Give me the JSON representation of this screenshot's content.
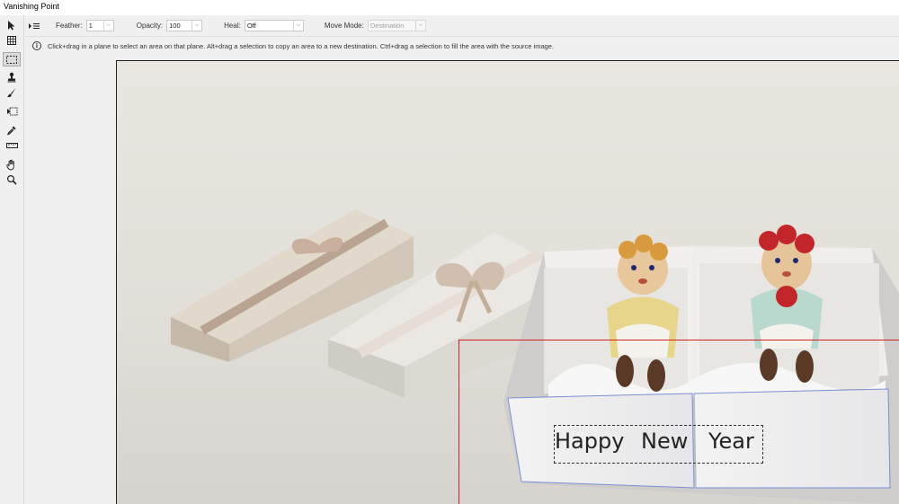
{
  "window": {
    "title": "Vanishing Point"
  },
  "options": {
    "menu_icon": "flyout-menu-icon",
    "feather": {
      "label": "Feather:",
      "value": "1"
    },
    "opacity": {
      "label": "Opacity:",
      "value": "100"
    },
    "heal": {
      "label": "Heal:",
      "value": "Off"
    },
    "move_mode": {
      "label": "Move Mode:",
      "value": "Destination"
    }
  },
  "info": {
    "icon": "info-icon",
    "message": "Click+drag in a plane to select an area on that plane. Alt+drag a selection to copy an area to a new destination. Ctrl+drag a selection to fill the area with the source image."
  },
  "tools": [
    {
      "name": "edit-plane-tool",
      "icon": "arrow-pointer-icon"
    },
    {
      "name": "create-plane-tool",
      "icon": "grid-plane-icon"
    },
    {
      "name": "marquee-tool",
      "icon": "marquee-icon",
      "active": true
    },
    {
      "name": "stamp-tool",
      "icon": "stamp-icon"
    },
    {
      "name": "brush-tool",
      "icon": "brush-icon"
    },
    {
      "name": "transform-tool",
      "icon": "transform-icon"
    },
    {
      "name": "eyedropper-tool",
      "icon": "eyedropper-icon"
    },
    {
      "name": "measure-tool",
      "icon": "ruler-icon"
    },
    {
      "name": "hand-tool",
      "icon": "hand-icon"
    },
    {
      "name": "zoom-tool",
      "icon": "magnifier-icon"
    }
  ],
  "canvas": {
    "image_text": {
      "word1": "Happy",
      "word2": "New",
      "word3": "Year"
    },
    "colors": {
      "selection": "#d42020",
      "plane": "#7a8fd6"
    }
  }
}
